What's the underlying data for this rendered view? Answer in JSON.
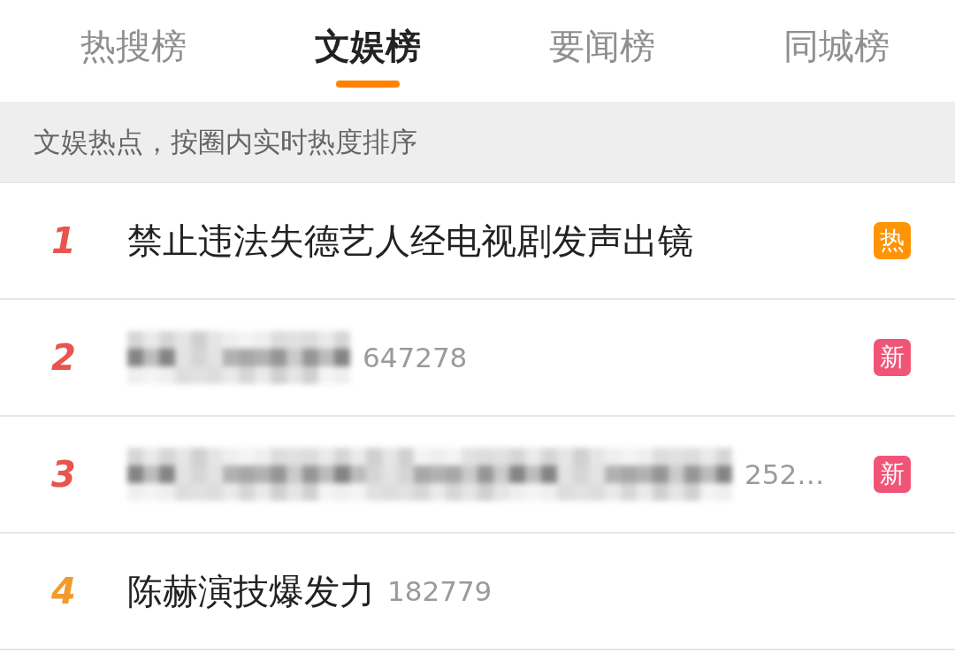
{
  "tabs": [
    {
      "label": "热搜榜",
      "selected": false
    },
    {
      "label": "文娱榜",
      "selected": true
    },
    {
      "label": "要闻榜",
      "selected": false
    },
    {
      "label": "同城榜",
      "selected": false
    }
  ],
  "subheader": "文娱热点，按圈内实时热度排序",
  "rows": [
    {
      "rank": "1",
      "color": "#e8554e",
      "kind": "text",
      "title": "禁止违法失德艺人经电视剧发声出镜",
      "badge": {
        "text": "热",
        "color": "#ff9406"
      }
    },
    {
      "rank": "2",
      "color": "#e8554e",
      "kind": "redacted_short",
      "count": "647278",
      "badge": {
        "text": "新",
        "color": "#f05578"
      }
    },
    {
      "rank": "3",
      "color": "#e8554e",
      "kind": "redacted_long",
      "count": "252…",
      "badge": {
        "text": "新",
        "color": "#f05578"
      }
    },
    {
      "rank": "4",
      "color": "#f29a2e",
      "kind": "text",
      "title": "陈赫演技爆发力",
      "count": "182779"
    }
  ]
}
